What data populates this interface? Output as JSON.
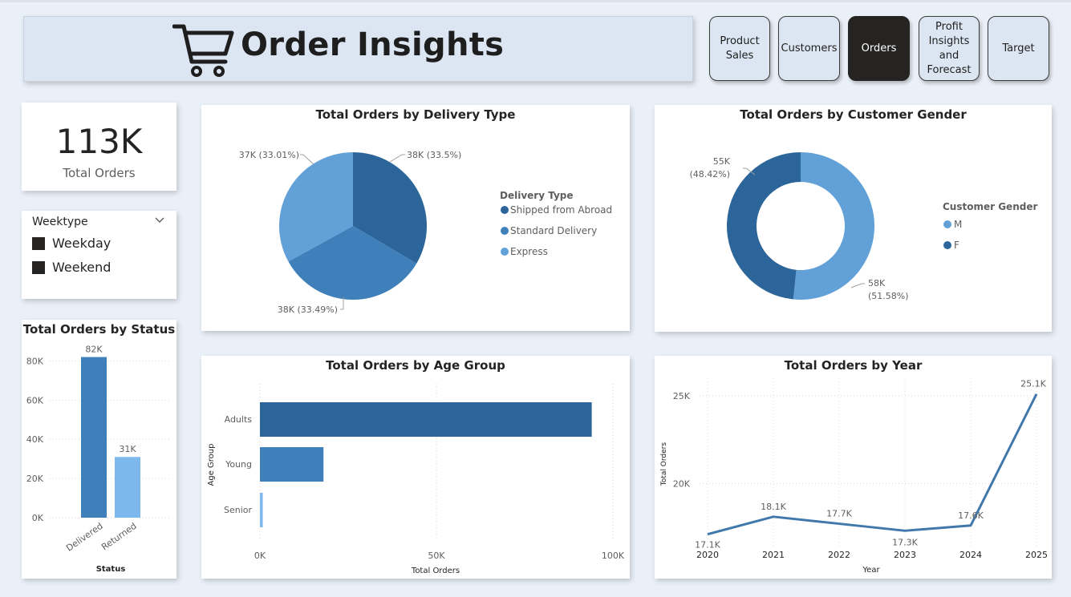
{
  "header": {
    "title": "Order Insights",
    "icon": "shopping-cart-icon"
  },
  "nav": [
    {
      "label": "Product Sales",
      "active": false
    },
    {
      "label": "Customers",
      "active": false
    },
    {
      "label": "Orders",
      "active": true
    },
    {
      "label": "Profit Insights and Forecast",
      "active": false
    },
    {
      "label": "Target",
      "active": false
    }
  ],
  "kpi": {
    "value": "113K",
    "label": "Total Orders"
  },
  "slicer": {
    "title": "Weektype",
    "items": [
      "Weekday",
      "Weekend"
    ]
  },
  "colors": {
    "dark_blue": "#2c6599",
    "mid_blue": "#4080ba",
    "light_blue": "#62a0d8",
    "pale_blue": "#7db8ec",
    "line": "#4178ac"
  },
  "chart_data": [
    {
      "id": "delivery",
      "type": "pie",
      "title": "Total Orders by Delivery Type",
      "legend_title": "Delivery Type",
      "legend_position": "right",
      "slices": [
        {
          "name": "Shipped from Abroad",
          "value": 38,
          "label": "38K (33.5%)",
          "percent": 33.5
        },
        {
          "name": "Standard Delivery",
          "value": 38,
          "label": "38K (33.49%)",
          "percent": 33.49
        },
        {
          "name": "Express",
          "value": 37,
          "label": "37K (33.01%)",
          "percent": 33.01
        }
      ]
    },
    {
      "id": "gender",
      "type": "donut",
      "title": "Total Orders by Customer Gender",
      "legend_title": "Customer Gender",
      "legend_position": "right",
      "slices": [
        {
          "name": "M",
          "value": 58,
          "label_value": "58K",
          "label_pct": "(51.58%)",
          "percent": 51.58
        },
        {
          "name": "F",
          "value": 55,
          "label_value": "55K",
          "label_pct": "(48.42%)",
          "percent": 48.42
        }
      ]
    },
    {
      "id": "status",
      "type": "bar",
      "title": "Total Orders by Status",
      "xlabel": "Status",
      "categories": [
        "Delivered",
        "Returned"
      ],
      "values": [
        82,
        31
      ],
      "value_labels": [
        "82K",
        "31K"
      ],
      "ylim": [
        0,
        90
      ],
      "yticks": [
        0,
        20,
        40,
        60,
        80
      ],
      "ytick_labels": [
        "0K",
        "20K",
        "40K",
        "60K",
        "80K"
      ],
      "grid": true
    },
    {
      "id": "age",
      "type": "bar",
      "orientation": "horizontal",
      "title": "Total Orders by Age Group",
      "xlabel": "Total Orders",
      "ylabel": "Age Group",
      "categories": [
        "Adults",
        "Young",
        "Senior"
      ],
      "values": [
        94,
        18,
        0.8
      ],
      "xlim": [
        0,
        100
      ],
      "xticks": [
        0,
        50,
        100
      ],
      "xtick_labels": [
        "0K",
        "50K",
        "100K"
      ],
      "grid": true
    },
    {
      "id": "year",
      "type": "line",
      "title": "Total Orders by Year",
      "xlabel": "Year",
      "ylabel": "Total Orders",
      "x": [
        "2020",
        "2021",
        "2022",
        "2023",
        "2024",
        "2025"
      ],
      "values": [
        17.1,
        18.1,
        17.7,
        17.3,
        17.6,
        25.1
      ],
      "value_labels": [
        "17.1K",
        "18.1K",
        "17.7K",
        "17.3K",
        "17.6K",
        "25.1K"
      ],
      "ylim": [
        16.4,
        26
      ],
      "yticks": [
        20,
        25
      ],
      "ytick_labels": [
        "20K",
        "25K"
      ],
      "grid": true
    }
  ]
}
